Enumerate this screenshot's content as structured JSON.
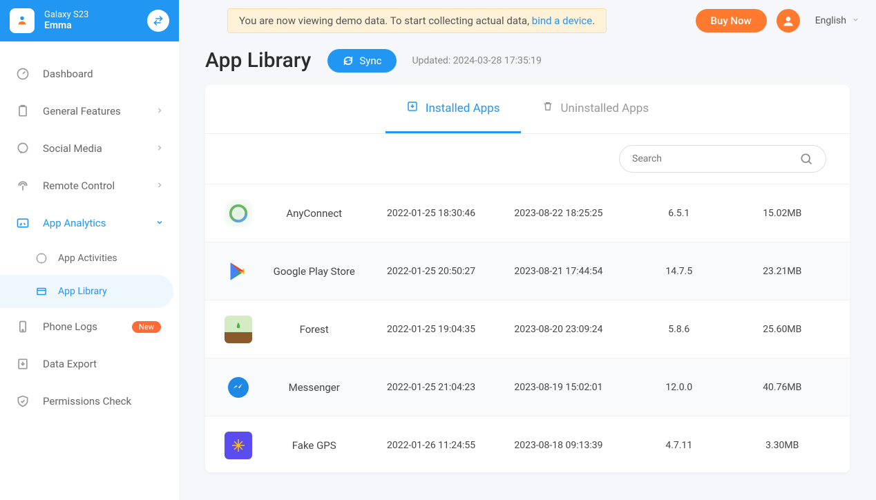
{
  "header": {
    "device": "Galaxy S23",
    "user": "Emma"
  },
  "sidebar": {
    "items": [
      {
        "label": "Dashboard"
      },
      {
        "label": "General Features"
      },
      {
        "label": "Social Media"
      },
      {
        "label": "Remote Control"
      },
      {
        "label": "App Analytics"
      },
      {
        "label": "Phone Logs",
        "badge": "New"
      },
      {
        "label": "Data Export"
      },
      {
        "label": "Permissions Check"
      }
    ],
    "subItems": [
      {
        "label": "App Activities"
      },
      {
        "label": "App Library"
      }
    ]
  },
  "topbar": {
    "banner_text": "You are now viewing demo data. To start collecting actual data, ",
    "banner_link": "bind a device",
    "banner_period": ".",
    "buy": "Buy Now",
    "lang": "English"
  },
  "page": {
    "title": "App Library",
    "sync": "Sync",
    "updated": "Updated: 2024-03-28 17:35:19"
  },
  "tabs": {
    "installed": "Installed Apps",
    "uninstalled": "Uninstalled Apps"
  },
  "search": {
    "placeholder": "Search"
  },
  "apps": [
    {
      "name": "AnyConnect",
      "d1": "2022-01-25 18:30:46",
      "d2": "2023-08-22 18:25:25",
      "ver": "6.5.1",
      "size": "15.02MB",
      "iconColor": "#6bb56b"
    },
    {
      "name": "Google Play Store",
      "d1": "2022-01-25 20:50:27",
      "d2": "2023-08-21 17:44:54",
      "ver": "14.7.5",
      "size": "23.21MB",
      "iconColor": "#fff"
    },
    {
      "name": "Forest",
      "d1": "2022-01-25 19:04:35",
      "d2": "2023-08-20 23:09:24",
      "ver": "5.8.6",
      "size": "25.60MB",
      "iconColor": "#8bc34a"
    },
    {
      "name": "Messenger",
      "d1": "2022-01-25 21:04:23",
      "d2": "2023-08-19 15:02:01",
      "ver": "12.0.0",
      "size": "40.76MB",
      "iconColor": "#1e88e5"
    },
    {
      "name": "Fake GPS",
      "d1": "2022-01-26 11:24:55",
      "d2": "2023-08-18 09:13:39",
      "ver": "4.7.11",
      "size": "3.30MB",
      "iconColor": "#5b4cf0"
    }
  ]
}
